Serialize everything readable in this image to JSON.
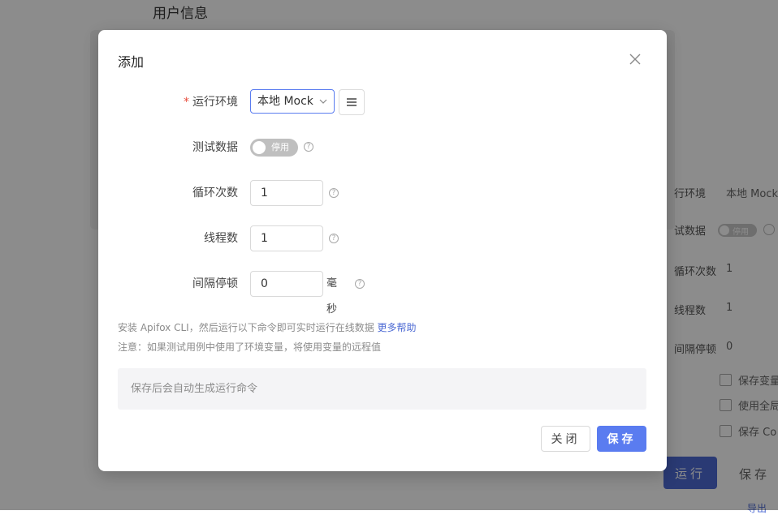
{
  "background": {
    "page_title": "用户信息",
    "form": {
      "rows": [
        {
          "label": "行环境",
          "value": "本地 Mock"
        },
        {
          "label": "试数据",
          "value": "停用"
        },
        {
          "label": "循环次数",
          "value": "1"
        },
        {
          "label": "线程数",
          "value": "1"
        },
        {
          "label": "间隔停顿",
          "value": "0"
        }
      ],
      "checkboxes": [
        "保存变量",
        "使用全局",
        "保存 Co"
      ],
      "run_label": "运行",
      "save_label": "保存",
      "export_label": "导出"
    }
  },
  "modal": {
    "title": "添加",
    "fields": {
      "environment": {
        "label": "运行环境",
        "required_mark": "*",
        "value": "本地 Mock"
      },
      "test_data": {
        "label": "测试数据",
        "toggle_label": "停用",
        "help": "?"
      },
      "loop_count": {
        "label": "循环次数",
        "value": "1",
        "help": "?"
      },
      "threads": {
        "label": "线程数",
        "value": "1",
        "help": "?"
      },
      "interval": {
        "label": "间隔停顿",
        "value": "0",
        "unit": "毫秒",
        "help": "?"
      }
    },
    "hint_line1": "安装 Apifox CLI，然后运行以下命令即可实时运行在线数据",
    "hint_link": "更多帮助",
    "hint_line2": "注意：如果测试用例中使用了环境变量，将使用变量的远程值",
    "command_placeholder": "保存后会自动生成运行命令",
    "close_button": "关闭",
    "save_button": "保存"
  },
  "colors": {
    "primary": "#5a7cf0",
    "required": "#e74c3c",
    "link": "#4e6bd4"
  }
}
